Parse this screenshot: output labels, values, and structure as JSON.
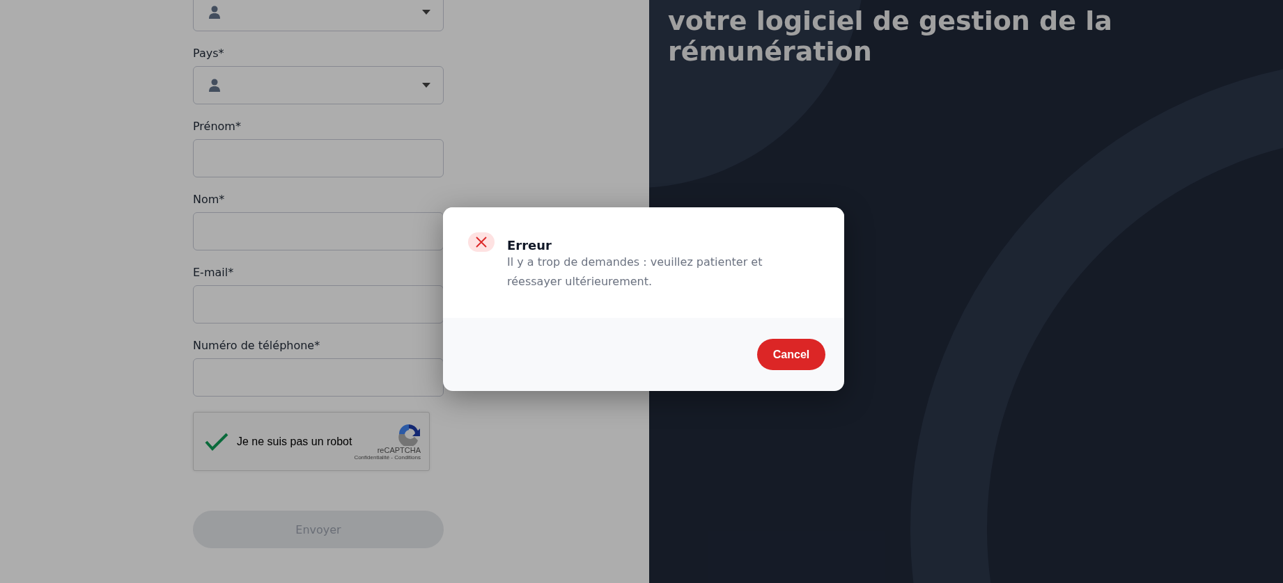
{
  "form": {
    "fields": [
      {
        "kind": "select"
      },
      {
        "kind": "select",
        "label": "Pays*"
      },
      {
        "kind": "text",
        "label": "Prénom*"
      },
      {
        "kind": "text",
        "label": "Nom*"
      },
      {
        "kind": "text",
        "label": "E-mail*"
      },
      {
        "kind": "text",
        "label": "Numéro de téléphone*"
      }
    ],
    "captcha": {
      "checked": true,
      "label": "Je ne suis pas un robot",
      "brand": "reCAPTCHA",
      "links": "Confidentialité - Conditions"
    },
    "submit": {
      "label": "Envoyer",
      "disabled": true
    }
  },
  "hero": {
    "heading": "votre logiciel de gestion de la rémunération"
  },
  "dialog": {
    "title": "Erreur",
    "message": "Il y a trop de demandes : veuillez patienter et réessayer ultérieurement.",
    "button": "Cancel"
  }
}
